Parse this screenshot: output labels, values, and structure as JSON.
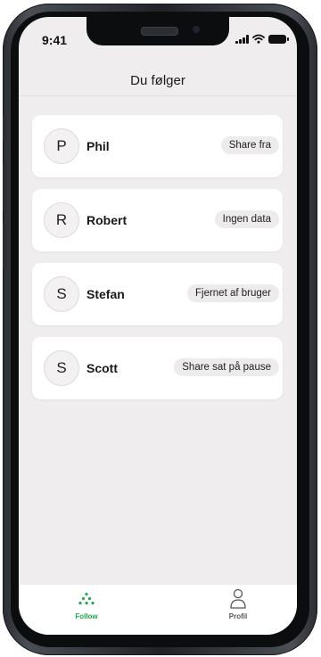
{
  "status_bar": {
    "time": "9:41",
    "icons": [
      "signal-icon",
      "wifi-icon",
      "battery-icon"
    ]
  },
  "header": {
    "title": "Du følger"
  },
  "following": [
    {
      "initial": "P",
      "name": "Phil",
      "status": "Share fra"
    },
    {
      "initial": "R",
      "name": "Robert",
      "status": "Ingen data"
    },
    {
      "initial": "S",
      "name": "Stefan",
      "status": "Fjernet af bruger"
    },
    {
      "initial": "S",
      "name": "Scott",
      "status": "Share sat på pause"
    }
  ],
  "tabs": [
    {
      "label": "Follow",
      "icon": "follow-dots-icon",
      "active": true
    },
    {
      "label": "Profil",
      "icon": "person-icon",
      "active": false
    }
  ],
  "colors": {
    "accent": "#20a84a",
    "background": "#efedee",
    "card": "#ffffff",
    "badge": "#edebec",
    "inactive_tab": "#555555"
  }
}
